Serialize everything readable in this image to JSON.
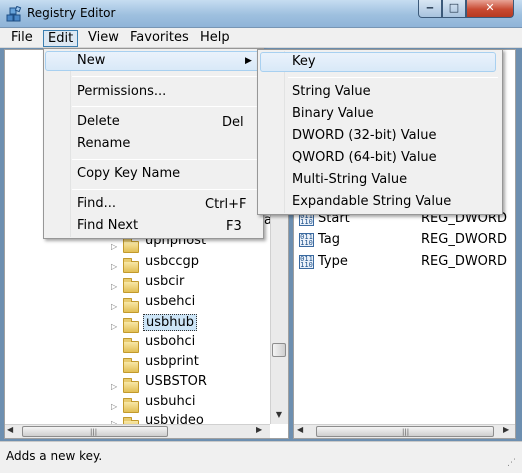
{
  "window": {
    "title": "Registry Editor",
    "icon": "regedit-icon",
    "minimize_glyph": "‒",
    "maximize_glyph": "□",
    "close_glyph": "✕"
  },
  "menubar": {
    "items": [
      "File",
      "Edit",
      "View",
      "Favorites",
      "Help"
    ],
    "active": "Edit"
  },
  "edit_menu": {
    "new_label": "New",
    "permissions_label": "Permissions...",
    "delete_label": "Delete",
    "delete_shortcut": "Del",
    "rename_label": "Rename",
    "copy_key_name_label": "Copy Key Name",
    "find_label": "Find...",
    "find_shortcut": "Ctrl+F",
    "find_next_label": "Find Next",
    "find_next_shortcut": "F3"
  },
  "new_submenu": {
    "items": [
      "Key",
      "String Value",
      "Binary Value",
      "DWORD (32-bit) Value",
      "QWORD (64-bit) Value",
      "Multi-String Value",
      "Expandable String Value"
    ],
    "highlighted": "Key"
  },
  "tree": {
    "partial_label": "a",
    "items": [
      {
        "label": "uphphost",
        "selected": false
      },
      {
        "label": "usbccgp",
        "selected": false
      },
      {
        "label": "usbcir",
        "selected": false
      },
      {
        "label": "usbehci",
        "selected": false
      },
      {
        "label": "usbhub",
        "selected": true
      },
      {
        "label": "usbohci",
        "selected": false
      },
      {
        "label": "usbprint",
        "selected": false
      },
      {
        "label": "USBSTOR",
        "selected": false
      },
      {
        "label": "usbuhci",
        "selected": false
      },
      {
        "label": "usbvideo",
        "selected": false
      }
    ]
  },
  "values_list": {
    "rows": [
      {
        "name": "Start",
        "type": "REG_DWORD"
      },
      {
        "name": "Tag",
        "type": "REG_DWORD"
      },
      {
        "name": "Type",
        "type": "REG_DWORD"
      }
    ]
  },
  "status_bar": {
    "text": "Adds a new key."
  },
  "colors": {
    "title_gradient_top": "#c6ddf1",
    "close_button": "#c84a32",
    "menu_highlight": "#d9e9f8",
    "selection": "#cde5f7"
  }
}
